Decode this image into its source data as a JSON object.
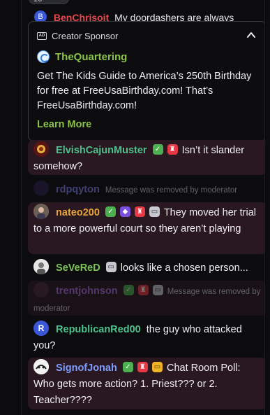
{
  "top_pill": "16",
  "partial_message": {
    "avatar_letter": "B",
    "username": "BenChrisoit",
    "text": "My doordashers are always"
  },
  "sponsor": {
    "label": "Creator Sponsor",
    "brand": "TheQuartering",
    "text": "Get The Kids Guide to America’s 250th Birthday for free at FreeUsaBirthday.com! That’s FreeUsaBirthday.com!",
    "cta": "Learn More"
  },
  "messages": [
    {
      "username": "ElvishCajunMuster",
      "color": "#4fc08d",
      "text": "Isn’t it slander somehow?"
    },
    {
      "username": "rdpqyton",
      "color": "#7d7df0",
      "text": "Message was removed by moderator"
    },
    {
      "username": "nateo200",
      "color": "#e8a33d",
      "text": "They moved her trial to a more powerful court so they aren’t playing"
    },
    {
      "username": "SeVeReD",
      "color": "#7cc35a",
      "text": "looks like a chosen person..."
    },
    {
      "username": "trentjohnson",
      "color": "#a86ce0",
      "text": "Message was removed by moderator"
    },
    {
      "username": "RepublicanRed00",
      "color": "#4fc08d",
      "avatar_letter": "R",
      "text": "the guy who attacked you?"
    },
    {
      "username": "SignofJonah",
      "color": "#7d9bff",
      "text": "Chat Room Poll: Who gets more action? 1. Priest??? or 2. Teacher????"
    }
  ]
}
